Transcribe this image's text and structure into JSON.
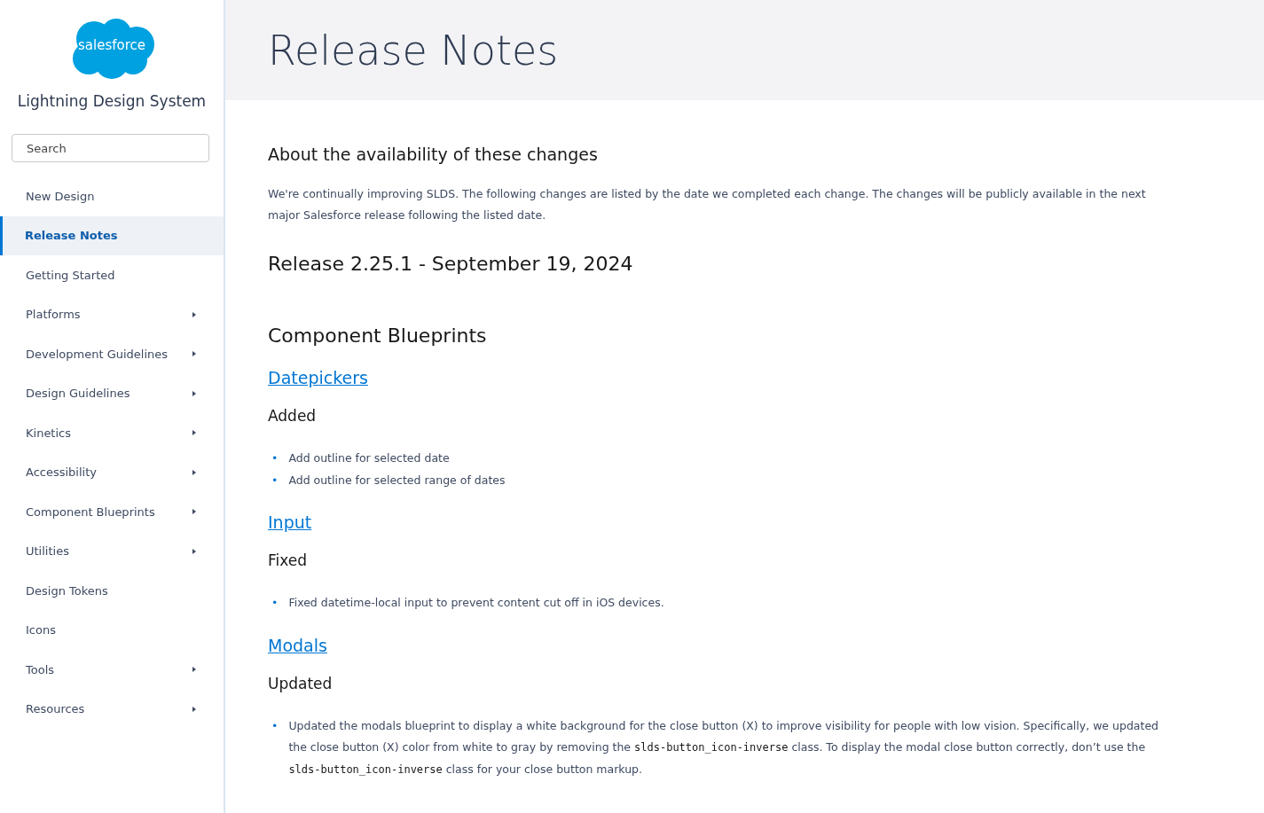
{
  "logo": {
    "text": "salesforce",
    "subtitle": "Lightning Design System"
  },
  "search": {
    "placeholder": "Search"
  },
  "nav": [
    {
      "label": "New Design",
      "selected": false,
      "has_children": false
    },
    {
      "label": "Release Notes",
      "selected": true,
      "has_children": false
    },
    {
      "label": "Getting Started",
      "selected": false,
      "has_children": false
    },
    {
      "label": "Platforms",
      "selected": false,
      "has_children": true
    },
    {
      "label": "Development Guidelines",
      "selected": false,
      "has_children": true
    },
    {
      "label": "Design Guidelines",
      "selected": false,
      "has_children": true
    },
    {
      "label": "Kinetics",
      "selected": false,
      "has_children": true
    },
    {
      "label": "Accessibility",
      "selected": false,
      "has_children": true
    },
    {
      "label": "Component Blueprints",
      "selected": false,
      "has_children": true
    },
    {
      "label": "Utilities",
      "selected": false,
      "has_children": true
    },
    {
      "label": "Design Tokens",
      "selected": false,
      "has_children": false
    },
    {
      "label": "Icons",
      "selected": false,
      "has_children": false
    },
    {
      "label": "Tools",
      "selected": false,
      "has_children": true
    },
    {
      "label": "Resources",
      "selected": false,
      "has_children": true
    }
  ],
  "page_title": "Release Notes",
  "intro": {
    "heading": "About the availability of these changes",
    "text": "We're continually improving SLDS. The following changes are listed by the date we completed each change. The changes will be publicly available in the next major Salesforce release following the listed date."
  },
  "release": {
    "title": "Release 2.25.1 - September 19, 2024",
    "category": "Component Blueprints",
    "components": [
      {
        "name": "Datepickers",
        "change": "Added",
        "items": [
          {
            "marker": "•",
            "parts": [
              {
                "kind": "text",
                "text": "Add outline for selected date"
              }
            ]
          },
          {
            "marker": "•",
            "parts": [
              {
                "kind": "text",
                "text": "Add outline for selected range of dates"
              }
            ]
          }
        ]
      },
      {
        "name": "Input",
        "change": "Fixed",
        "items": [
          {
            "marker": "•",
            "parts": [
              {
                "kind": "text",
                "text": "Fixed datetime-local input to prevent content cut off in iOS devices."
              }
            ]
          }
        ]
      },
      {
        "name": "Modals",
        "change": "Updated",
        "items": [
          {
            "marker": "•",
            "parts": [
              {
                "kind": "text",
                "text": "Updated the modals blueprint to display a white background for the close button (X) to improve visibility for people with low vision. Specifically, we updated the close button (X) color from white to gray by removing the "
              },
              {
                "kind": "code",
                "text": "slds-button_icon-inverse"
              },
              {
                "kind": "text",
                "text": " class. To display the modal close button correctly, don’t use the "
              },
              {
                "kind": "code",
                "text": "slds-button_icon-inverse"
              },
              {
                "kind": "text",
                "text": " class for your close button markup."
              }
            ]
          }
        ]
      }
    ]
  }
}
